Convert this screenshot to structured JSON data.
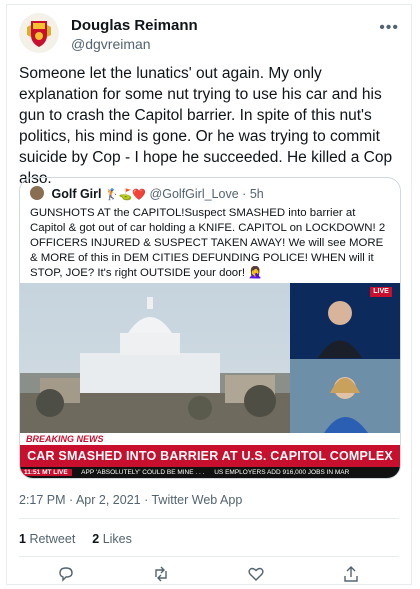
{
  "tweet": {
    "author_name": "Douglas Reimann",
    "author_handle": "@dgvreiman",
    "text": "Someone let the lunatics' out again.  My only explanation for some nut trying to use his car and his gun to crash the Capitol barrier.  In spite of this nut's politics, his mind is gone.  Or he was trying to commit suicide by Cop - I hope he succeeded.  He killed a Cop also.",
    "timestamp": "2:17 PM · Apr 2, 2021 · Twitter Web App",
    "retweets_count": "1",
    "retweets_label": "Retweet",
    "likes_count": "2",
    "likes_label": "Likes"
  },
  "quoted": {
    "author_name": "Golf Girl",
    "author_emojis": "🏌️⛳❤️",
    "author_handle": "@GolfGirl_Love",
    "separator": "·",
    "time": "5h",
    "text": "GUNSHOTS AT the CAPITOL!Suspect SMASHED into barrier at Capitol & got out of car holding a KNIFE. CAPITOL on LOCKDOWN! 2 OFFICERS INJURED & SUSPECT TAKEN AWAY! We will see MORE & MORE of this in DEM CITIES DEFUNDING POLICE! WHEN will it STOP, JOE? It's right OUTSIDE your door! 🤦‍♀️",
    "media": {
      "live_tag": "LIVE",
      "breaking": "BREAKING NEWS",
      "headline": "CAR SMASHED INTO BARRIER AT U.S. CAPITOL COMPLEX",
      "ticker_time": "11:51 MT  LIVE",
      "ticker_items": [
        "APP 'ABSOLUTELY' COULD BE MINE . . .",
        "US EMPLOYERS ADD 916,000 JOBS IN MAR"
      ]
    }
  },
  "colors": {
    "text_primary": "#0f1419",
    "text_secondary": "#536471",
    "border": "#e6ecf0",
    "news_red": "#c8102e"
  },
  "icons": {
    "more": "more-horizontal-icon",
    "reply": "reply-icon",
    "retweet": "retweet-icon",
    "like": "heart-icon",
    "share": "share-icon"
  }
}
